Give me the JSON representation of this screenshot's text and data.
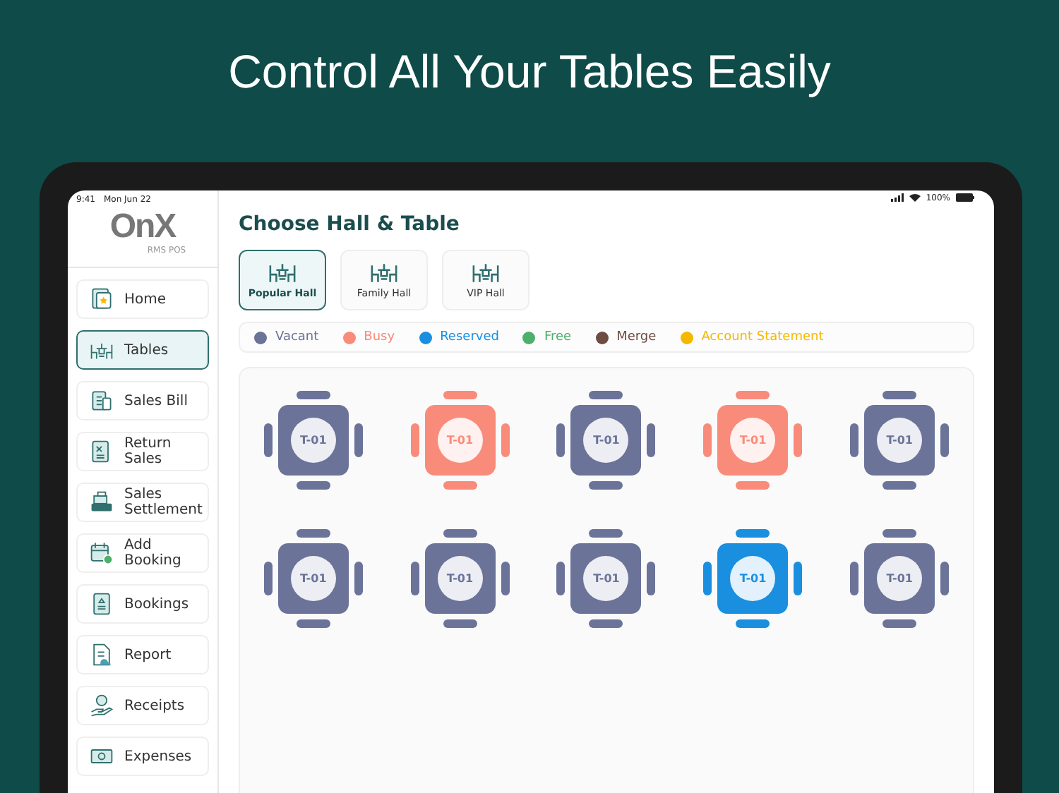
{
  "headline": "Control All Your Tables Easily",
  "status_bar": {
    "time": "9:41",
    "date": "Mon Jun 22",
    "battery": "100%"
  },
  "logo": {
    "text": "OnX",
    "tagline": "RMS POS"
  },
  "sidebar": {
    "items": [
      {
        "label": "Home",
        "kind": "home",
        "selected": false
      },
      {
        "label": "Tables",
        "kind": "tables",
        "selected": true
      },
      {
        "label": "Sales Bill",
        "kind": "bill",
        "selected": false
      },
      {
        "label": "Return Sales",
        "kind": "return",
        "selected": false
      },
      {
        "label": "Sales Settlement",
        "kind": "register",
        "selected": false
      },
      {
        "label": "Add Booking",
        "kind": "calendar",
        "selected": false
      },
      {
        "label": "Bookings",
        "kind": "book",
        "selected": false
      },
      {
        "label": "Report",
        "kind": "report",
        "selected": false
      },
      {
        "label": "Receipts",
        "kind": "hand",
        "selected": false
      },
      {
        "label": "Expenses",
        "kind": "money",
        "selected": false
      }
    ]
  },
  "title": "Choose Hall & Table",
  "halls": [
    {
      "label": "Popular Hall",
      "selected": true
    },
    {
      "label": "Family Hall",
      "selected": false
    },
    {
      "label": "VIP Hall",
      "selected": false
    }
  ],
  "legend": [
    {
      "label": "Vacant",
      "color": "#6b7399"
    },
    {
      "label": "Busy",
      "color": "#f98b7a"
    },
    {
      "label": "Reserved",
      "color": "#1a8fe0"
    },
    {
      "label": "Free",
      "color": "#4caf6a"
    },
    {
      "label": "Merge",
      "color": "#6d4c41"
    },
    {
      "label": "Account Statement",
      "color": "#f5b800"
    }
  ],
  "tables": [
    {
      "label": "T-01",
      "color": "#6b7399"
    },
    {
      "label": "T-01",
      "color": "#f98b7a"
    },
    {
      "label": "T-01",
      "color": "#6b7399"
    },
    {
      "label": "T-01",
      "color": "#f98b7a"
    },
    {
      "label": "T-01",
      "color": "#6b7399"
    },
    {
      "label": "T-01",
      "color": "#6b7399"
    },
    {
      "label": "T-01",
      "color": "#6b7399"
    },
    {
      "label": "T-01",
      "color": "#6b7399"
    },
    {
      "label": "T-01",
      "color": "#1a8fe0"
    },
    {
      "label": "T-01",
      "color": "#6b7399"
    }
  ]
}
